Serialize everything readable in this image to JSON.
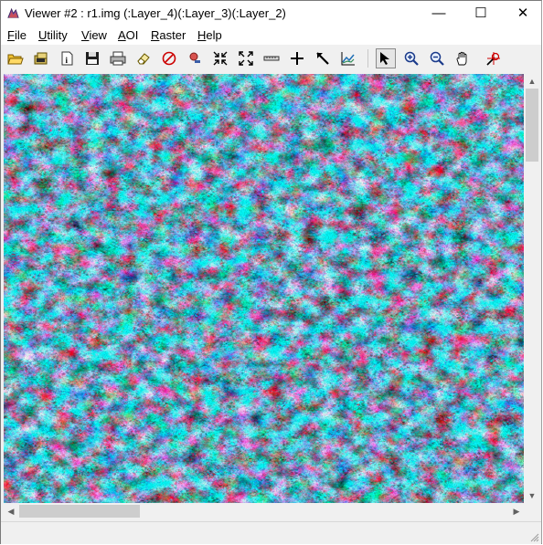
{
  "window": {
    "title": "Viewer #2 : r1.img (:Layer_4)(:Layer_3)(:Layer_2)",
    "controls": {
      "minimize": "—",
      "maximize": "☐",
      "close": "✕"
    }
  },
  "menu": [
    {
      "underline": "F",
      "rest": "ile"
    },
    {
      "underline": "U",
      "rest": "tility"
    },
    {
      "underline": "V",
      "rest": "iew"
    },
    {
      "underline": "A",
      "rest": "OI"
    },
    {
      "underline": "R",
      "rest": "aster"
    },
    {
      "underline": "H",
      "rest": "elp"
    }
  ],
  "toolbar": {
    "icons": [
      "open-folder-icon",
      "open-multi-icon",
      "info-icon",
      "save-icon",
      "print-icon",
      "eraser-icon",
      "target-icon",
      "inquire-icon",
      "fit-inward-icon",
      "fit-outward-icon",
      "measure-icon",
      "crosshair-icon",
      "arrow-tool-icon",
      "spectral-profile-icon",
      "select-pointer-icon",
      "zoom-in-icon",
      "zoom-out-icon",
      "pan-hand-icon",
      "inquire-cursor-icon"
    ],
    "active_tool": "select-pointer-icon"
  },
  "image": {
    "file": "r1.img",
    "layers": [
      "Layer_4",
      "Layer_3",
      "Layer_2"
    ],
    "palette": {
      "red": "#e07a7d",
      "cyan": "#86e0e2",
      "dark": "#2f3436",
      "gray": "#8f9799"
    }
  },
  "scroll": {
    "up": "▲",
    "down": "▼",
    "left": "◀",
    "right": "▶"
  }
}
